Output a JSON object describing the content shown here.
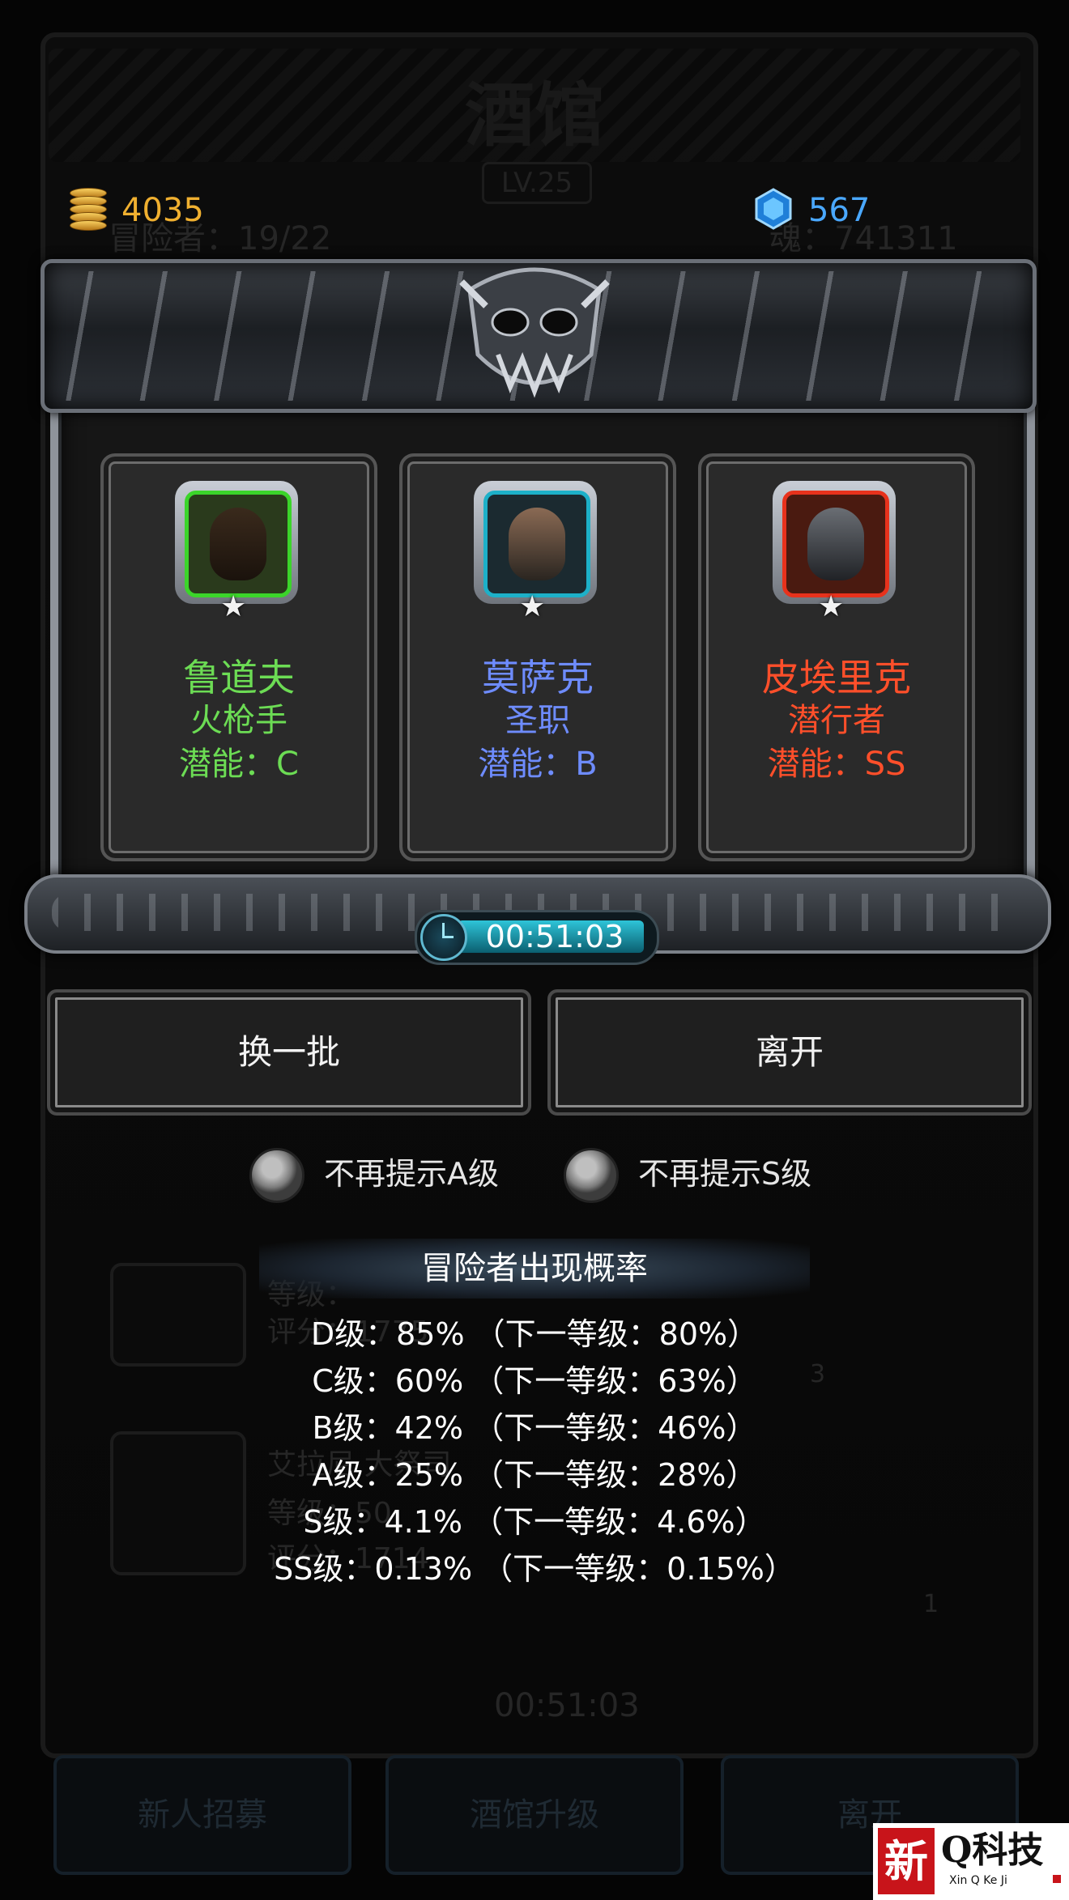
{
  "background": {
    "title": "酒馆",
    "level": "LV.25",
    "adventurers": "冒险者：19/22",
    "soul": "魂：741311",
    "timer": "00:51:03",
    "list_level_label": "等级：",
    "list_rating_1": "评分：1775",
    "list_name_2": "艾拉尼 大祭司",
    "list_level_2": "等级：50",
    "list_rating_2": "评分：1714",
    "badge_1": "3",
    "badge_2": "1",
    "buttons": [
      "新人招募",
      "酒馆升级",
      "离开"
    ]
  },
  "currency": {
    "gold": "4035",
    "gems": "567"
  },
  "heroes": [
    {
      "name": "鲁道夫",
      "class": "火枪手",
      "potential": "潜能：C",
      "color": "green",
      "frame": "#3bd52a"
    },
    {
      "name": "莫萨克",
      "class": "圣职",
      "potential": "潜能：B",
      "color": "blue",
      "frame": "#1db0c8"
    },
    {
      "name": "皮埃里克",
      "class": "潜行者",
      "potential": "潜能：SS",
      "color": "red",
      "frame": "#e8321c"
    }
  ],
  "star_glyph": "★",
  "timer": "00:51:03",
  "buttons": {
    "refresh": "换一批",
    "leave": "离开"
  },
  "toggles": {
    "no_prompt_a": "不再提示A级",
    "no_prompt_s": "不再提示S级"
  },
  "probability": {
    "title": "冒险者出现概率",
    "lines": [
      "D级：85% （下一等级：80%）",
      "C级：60% （下一等级：63%）",
      "B级：42% （下一等级：46%）",
      "A级：25% （下一等级：28%）",
      "S级：4.1% （下一等级：4.6%）",
      "SS级：0.13% （下一等级：0.15%）"
    ]
  },
  "watermark": {
    "mark": "新",
    "name": "Q科技",
    "sub": "Xin Q Ke Ji"
  },
  "colors": {
    "gold": "#f0b030",
    "gem": "#4aa8ff",
    "green": "#6cdc54",
    "blue": "#6e8cff",
    "red": "#ff4f2a"
  }
}
